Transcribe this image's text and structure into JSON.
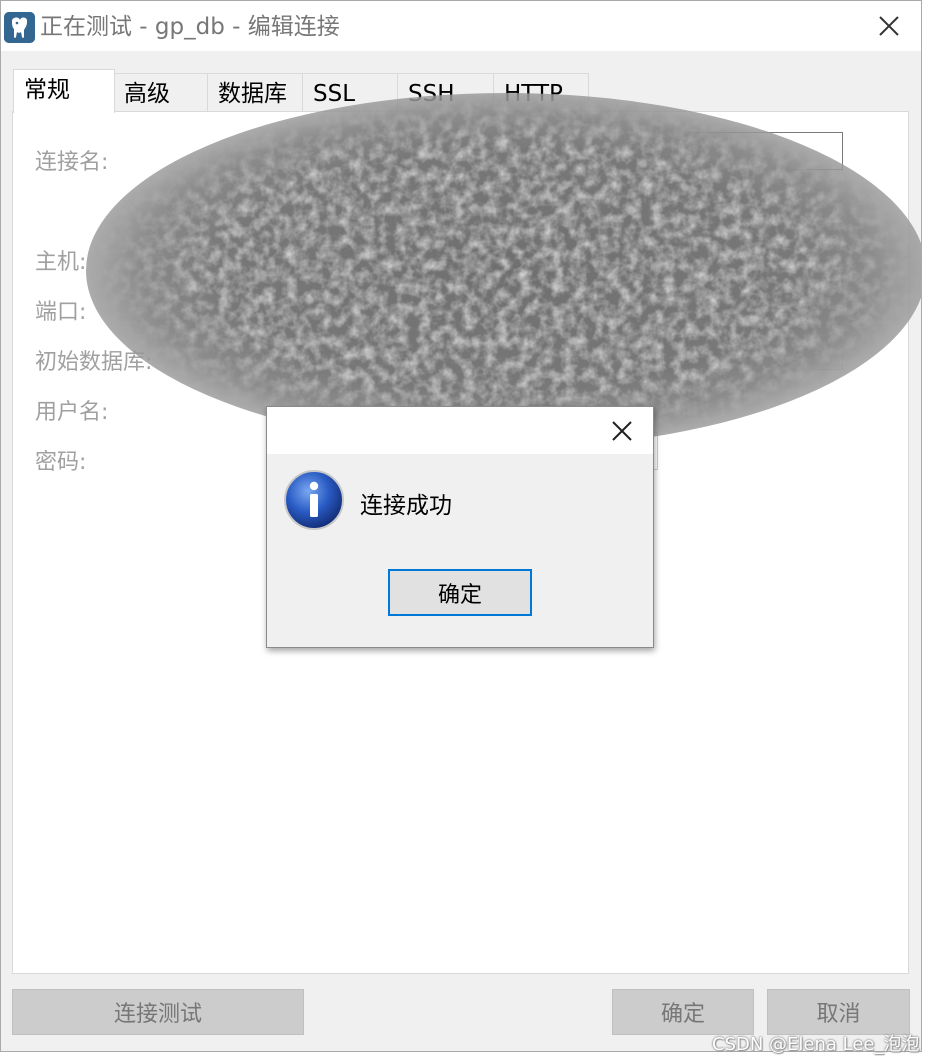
{
  "window": {
    "title": "正在测试 - gp_db - 编辑连接"
  },
  "tabs": [
    {
      "label": "常规",
      "active": true
    },
    {
      "label": "高级",
      "active": false
    },
    {
      "label": "数据库",
      "active": false
    },
    {
      "label": "SSL",
      "active": false
    },
    {
      "label": "SSH",
      "active": false
    },
    {
      "label": "HTTP",
      "active": false
    }
  ],
  "form": {
    "connection_name_label": "连接名:",
    "host_label": "主机:",
    "port_label": "端口:",
    "initial_db_label": "初始数据库:",
    "username_label": "用户名:",
    "password_label": "密码:"
  },
  "buttons": {
    "test_connection": "连接测试",
    "ok": "确定",
    "cancel": "取消"
  },
  "dialog": {
    "message": "连接成功",
    "ok_label": "确定"
  },
  "icons": {
    "app": "postgresql-elephant-icon",
    "close": "close-icon",
    "info": "info-icon"
  },
  "colors": {
    "focus_border": "#0078d7",
    "app_icon_bg": "#336791"
  },
  "watermark": "CSDN @Elena Lee_泡泡"
}
